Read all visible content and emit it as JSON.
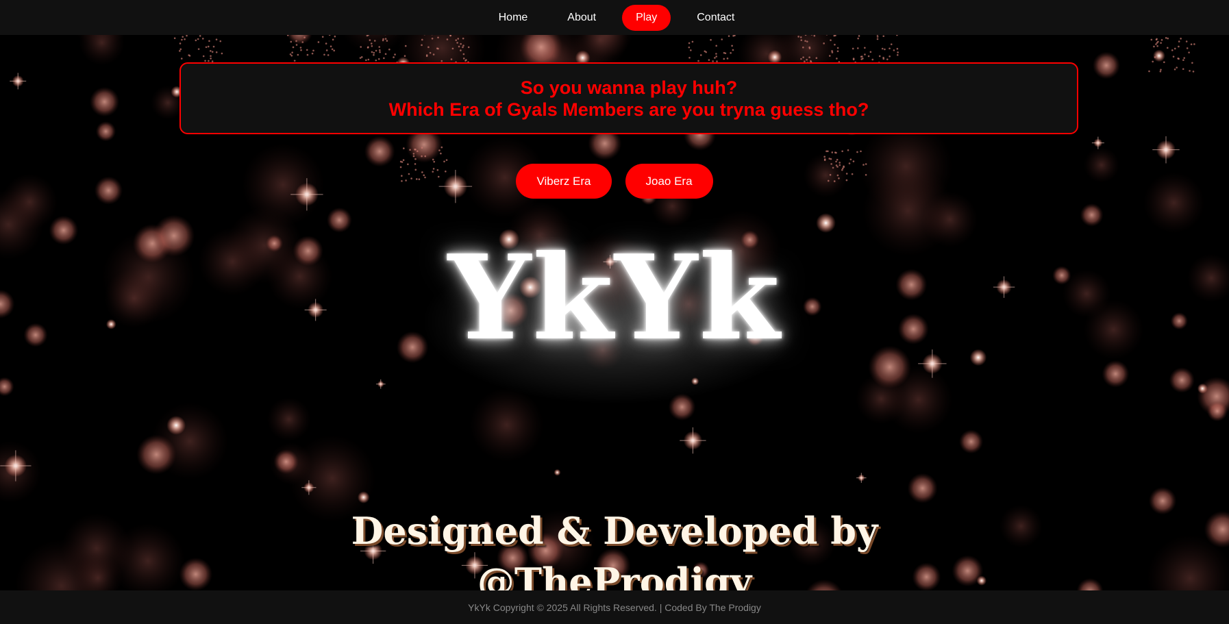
{
  "nav": {
    "items": [
      {
        "label": "Home",
        "active": false
      },
      {
        "label": "About",
        "active": false
      },
      {
        "label": "Play",
        "active": true
      },
      {
        "label": "Contact",
        "active": false
      }
    ]
  },
  "question": {
    "line1": "So you wanna play huh?",
    "line2": "Which Era of Gyals Members are you tryna guess tho?"
  },
  "era_buttons": [
    {
      "label": "Viberz Era"
    },
    {
      "label": "Joao Era"
    }
  ],
  "logo": {
    "text": "YkYk"
  },
  "credits": {
    "line1": "Designed & Developed by",
    "line2": "@TheProdigy"
  },
  "footer": {
    "text": "YkYk Copyright © 2025 All Rights Reserved. | Coded By The Prodigy"
  },
  "colors": {
    "accent": "#ff0000",
    "bar_bg": "#111111",
    "page_bg": "#000000",
    "bokeh": "#ff9a8a"
  }
}
